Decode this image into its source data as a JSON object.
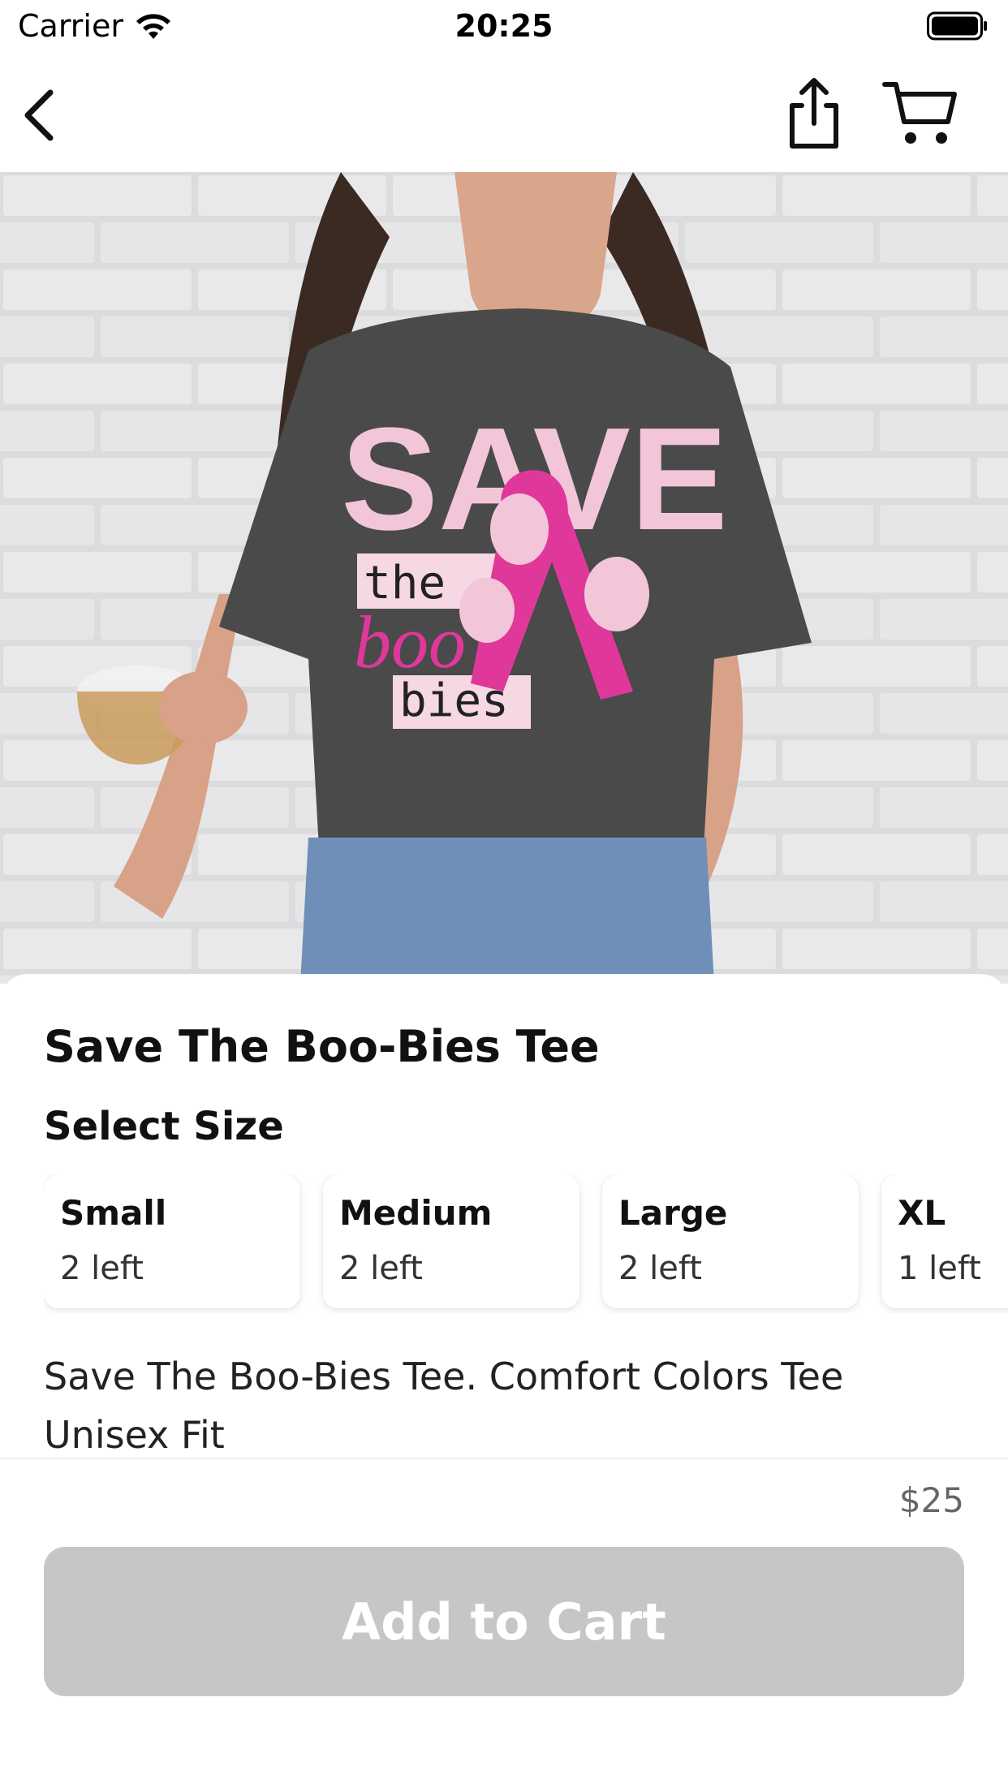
{
  "status_bar": {
    "carrier": "Carrier",
    "time": "20:25",
    "wifi_icon": "wifi-icon",
    "battery_icon": "battery-icon"
  },
  "nav": {
    "back_icon": "chevron-left-icon",
    "share_icon": "share-icon",
    "cart_icon": "cart-icon"
  },
  "hero": {
    "shirt_graphic": {
      "line1": "SAVE",
      "line2": "the",
      "line3": "boo",
      "line4": "bies"
    }
  },
  "product": {
    "title": "Save The Boo-Bies Tee",
    "size_heading": "Select Size",
    "sizes": [
      {
        "name": "Small",
        "stock": "2 left"
      },
      {
        "name": "Medium",
        "stock": "2 left"
      },
      {
        "name": "Large",
        "stock": "2 left"
      },
      {
        "name": "XL",
        "stock": "1 left"
      }
    ],
    "description_line1": "Save The Boo-Bies Tee. Comfort Colors Tee",
    "description_line2": "Unisex Fit"
  },
  "footer": {
    "price": "$25",
    "add_to_cart": "Add to Cart"
  },
  "colors": {
    "button_disabled": "#c6c6c8",
    "shirt": "#4a4a4a",
    "pink_accent": "#e0389a",
    "wall": "#d8d8da"
  }
}
